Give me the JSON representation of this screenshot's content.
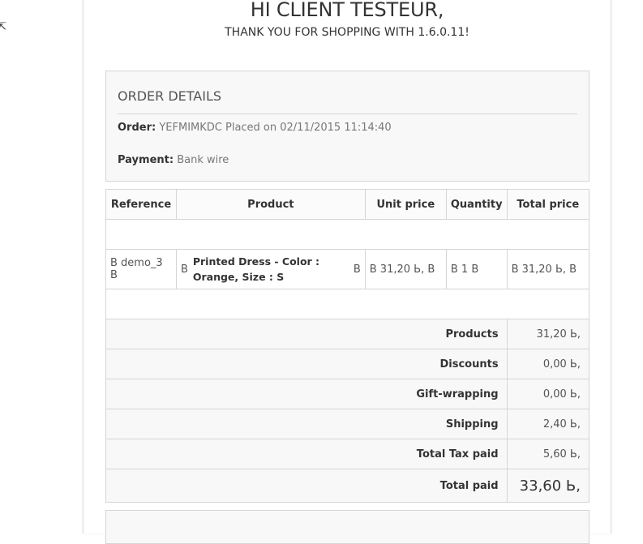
{
  "cursor": {
    "glyph": "⇱",
    "icon": "mouse-cursor-icon"
  },
  "header": {
    "greeting": "HI CLIENT TESTEUR,",
    "thanks": "THANK YOU FOR SHOPPING WITH 1.6.0.11!"
  },
  "order_details": {
    "title": "ORDER DETAILS",
    "order_label": "Order:",
    "order_value": "YEFMIMKDC Placed on 02/11/2015 11:14:40",
    "payment_label": "Payment:",
    "payment_value": "Bank wire"
  },
  "table": {
    "headers": [
      "Reference",
      "Product",
      "Unit price",
      "Quantity",
      "Total price"
    ],
    "item": {
      "reference": "В demo_3 В",
      "product_prefix": "В",
      "product_name": "Printed Dress - Color : Orange, Size : S",
      "product_suffix": "В",
      "unit_price": "В 31,20 Ь, В",
      "quantity": "В 1 В",
      "total_price": "В 31,20 Ь, В"
    }
  },
  "summary": [
    {
      "label": "Products",
      "value": "31,20 Ь,"
    },
    {
      "label": "Discounts",
      "value": "0,00 Ь,"
    },
    {
      "label": "Gift-wrapping",
      "value": "0,00 Ь,"
    },
    {
      "label": "Shipping",
      "value": "2,40 Ь,"
    },
    {
      "label": "Total Tax paid",
      "value": "5,60 Ь,"
    }
  ],
  "total": {
    "label": "Total paid",
    "value": "33,60 Ь,"
  }
}
